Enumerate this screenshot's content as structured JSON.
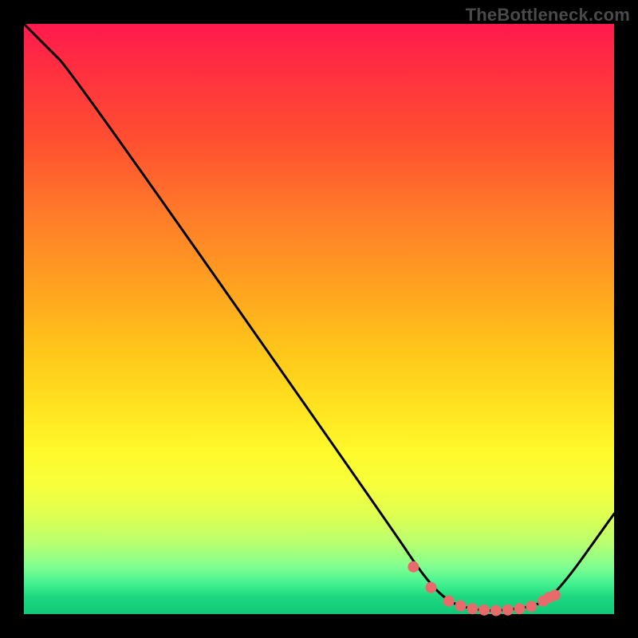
{
  "watermark": "TheBottleneck.com",
  "chart_data": {
    "type": "line",
    "title": "",
    "xlabel": "",
    "ylabel": "",
    "xlim": [
      0,
      100
    ],
    "ylim": [
      0,
      100
    ],
    "curve": [
      {
        "x": 0,
        "y": 100
      },
      {
        "x": 4,
        "y": 96
      },
      {
        "x": 8,
        "y": 92
      },
      {
        "x": 62,
        "y": 15
      },
      {
        "x": 68,
        "y": 6
      },
      {
        "x": 72,
        "y": 2
      },
      {
        "x": 76,
        "y": 0.8
      },
      {
        "x": 80,
        "y": 0.5
      },
      {
        "x": 86,
        "y": 1.2
      },
      {
        "x": 90,
        "y": 3
      },
      {
        "x": 100,
        "y": 17
      }
    ],
    "markers": [
      {
        "x": 66,
        "y": 8
      },
      {
        "x": 69,
        "y": 4.5
      },
      {
        "x": 72,
        "y": 2.2
      },
      {
        "x": 74,
        "y": 1.4
      },
      {
        "x": 76,
        "y": 0.9
      },
      {
        "x": 78,
        "y": 0.7
      },
      {
        "x": 80,
        "y": 0.6
      },
      {
        "x": 82,
        "y": 0.7
      },
      {
        "x": 84,
        "y": 0.9
      },
      {
        "x": 86,
        "y": 1.3
      },
      {
        "x": 88,
        "y": 2.2
      },
      {
        "x": 89,
        "y": 2.8
      },
      {
        "x": 90,
        "y": 3.2
      }
    ],
    "marker_color": "#e86a6a",
    "line_color": "#000000",
    "line_width": 3,
    "marker_radius": 7
  }
}
